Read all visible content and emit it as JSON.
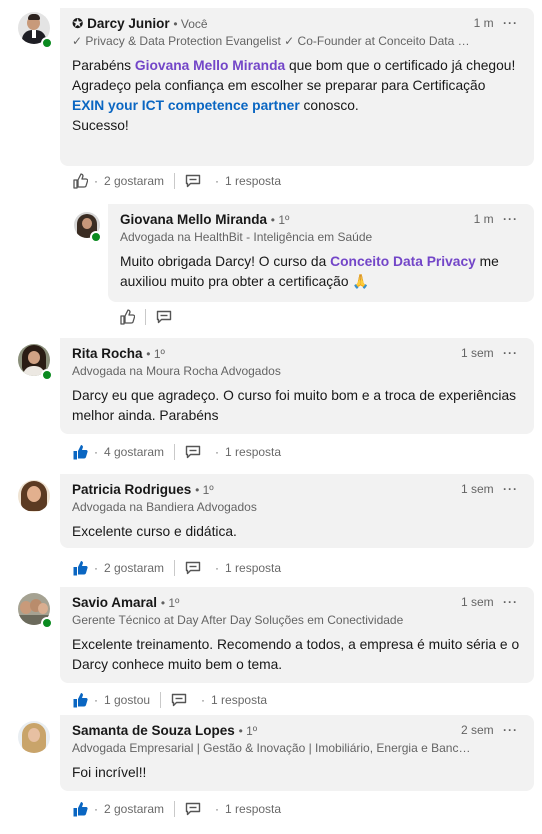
{
  "comments": [
    {
      "name": "Darcy Junior",
      "badge": "✪",
      "degree": "• Você",
      "headline": "✓ Privacy & Data Protection Evangelist ✓ Co-Founder at Conceito Data Pr...",
      "time": "1 m",
      "text": {
        "p1_a": "Parabéns ",
        "p1_mention": "Giovana Mello Miranda",
        "p1_b": " que bom que o certificado já chegou!",
        "p2_a": "Agradeço pela confiança em escolher se preparar para Certificação ",
        "p2_link": "EXIN your ICT competence partner",
        "p2_b": " conosco.",
        "p3": "Sucesso!"
      },
      "likes": "2 gostaram",
      "replies": "1 resposta"
    },
    {
      "name": "Giovana Mello Miranda",
      "degree": "• 1º",
      "headline": "Advogada na HealthBit - Inteligência em Saúde",
      "time": "1 m",
      "text": {
        "a": "Muito obrigada Darcy! O curso da ",
        "mention": "Conceito Data Privacy",
        "b": " me auxiliou muito pra obter a certificação 🙏"
      }
    },
    {
      "name": "Rita Rocha",
      "degree": "• 1º",
      "headline": "Advogada na Moura Rocha Advogados",
      "time": "1 sem",
      "text": "Darcy eu que agradeço. O curso foi muito bom e a troca de experiências melhor ainda. Parabéns",
      "likes": "4 gostaram",
      "replies": "1 resposta"
    },
    {
      "name": "Patricia Rodrigues",
      "degree": "• 1º",
      "headline": "Advogada na Bandiera Advogados",
      "time": "1 sem",
      "text": "Excelente curso e didática.",
      "likes": "2 gostaram",
      "replies": "1 resposta"
    },
    {
      "name": "Savio Amaral",
      "degree": "• 1º",
      "headline": "Gerente Técnico at Day After Day Soluções em Conectividade",
      "time": "1 sem",
      "text": "Excelente treinamento. Recomendo a todos, a empresa é muito séria e o Darcy conhece muito bem o tema.",
      "likes": "1 gostou",
      "replies": "1 resposta"
    },
    {
      "name": "Samanta de Souza Lopes",
      "degree": "• 1º",
      "headline": "Advogada Empresarial | Gestão & Inovação | Imobiliário, Energia e Bancos...",
      "time": "2 sem",
      "text": "Foi incrível!!",
      "likes": "2 gostaram",
      "replies": "1 resposta"
    }
  ],
  "ui": {
    "dot_sep": "·",
    "more_icon": "···",
    "colors": {
      "mention": "#7346c8",
      "link": "#0a66c2",
      "like_active": "#0a66c2",
      "bubble": "#f2f2f2",
      "presence": "#0a8a1f"
    }
  }
}
